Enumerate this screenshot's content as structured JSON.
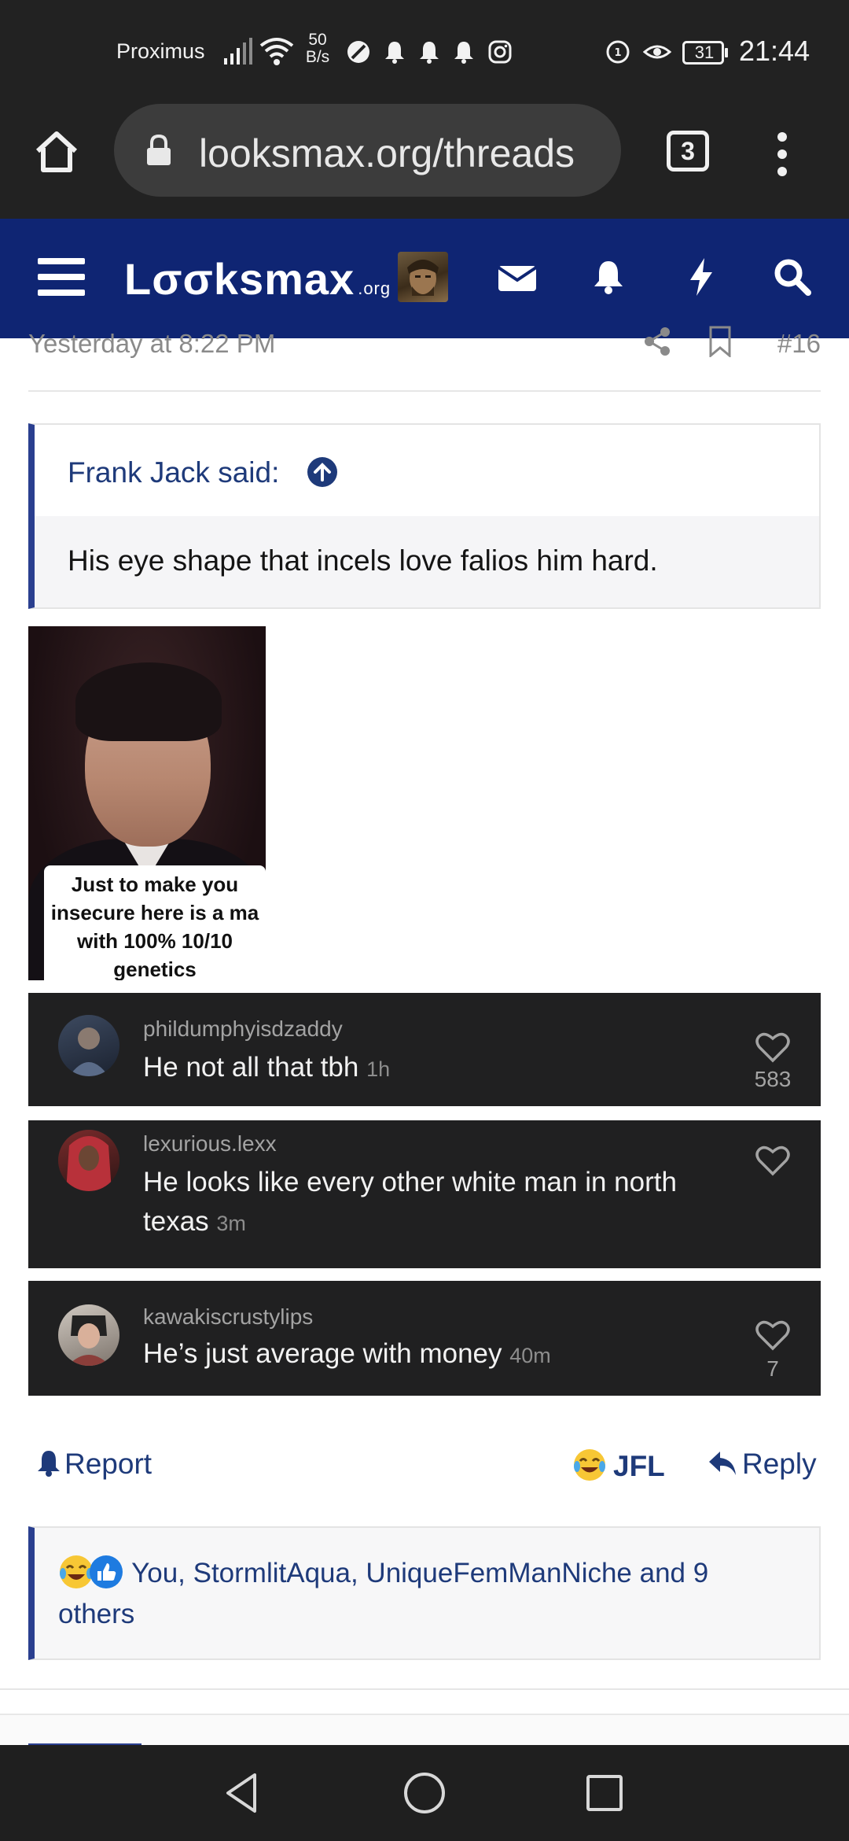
{
  "status_bar": {
    "carrier": "Proximus",
    "speed_value": "50",
    "speed_unit": "B/s",
    "battery": "31",
    "time": "21:44"
  },
  "browser": {
    "url": "looksmax.org/threads",
    "tab_count": "3"
  },
  "site": {
    "logo_text": "Lσσksmax",
    "logo_suffix": ".org"
  },
  "post": {
    "date": "Yesterday at 8:22 PM",
    "number": "#16",
    "quote": {
      "author": "Frank Jack said:",
      "text": "His eye shape that incels love falios him hard."
    },
    "image_caption": [
      "Just to make you",
      "insecure here is a ma",
      "with 100% 10/10",
      "genetics"
    ],
    "comments": [
      {
        "username": "phildumphyisdzaddy",
        "text": "He not all that tbh",
        "time": "1h",
        "likes": "583"
      },
      {
        "username": "lexurious.lexx",
        "text": "He looks like every other white man in north texas",
        "time": "3m",
        "likes": ""
      },
      {
        "username": "kawakiscrustylips",
        "text": "He’s just average with money",
        "time": "40m",
        "likes": "7"
      }
    ],
    "actions": {
      "report": "Report",
      "jfl": "JFL",
      "reply": "Reply"
    },
    "reactions_text": "You, StormlitAqua, UniqueFemManNiche and 9 others"
  },
  "colors": {
    "header_bg": "#0f2573",
    "link": "#1e3a7a",
    "comment_bg": "#202021"
  }
}
